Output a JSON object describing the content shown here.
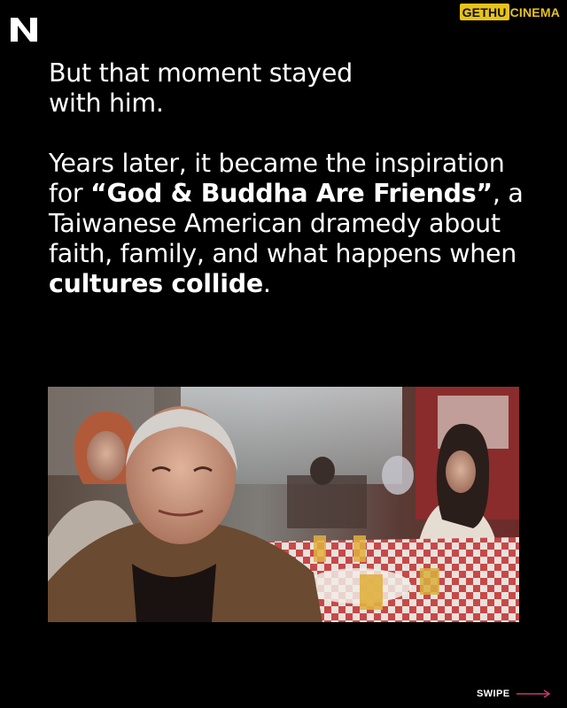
{
  "brand": {
    "part1": "GETHU",
    "part2": "CINEMA",
    "accent_color": "#e8c21a"
  },
  "logo": {
    "icon": "n-logo-icon"
  },
  "text": {
    "para1": "But that moment stayed with him.",
    "para2_segments": [
      {
        "text": "Years later, it became the inspiration for ",
        "bold": false
      },
      {
        "text": "“God & Buddha Are Friends”",
        "bold": true
      },
      {
        "text": ", a Taiwanese American dramedy about faith, family, and what happens when ",
        "bold": false
      },
      {
        "text": "cultures collide",
        "bold": true
      },
      {
        "text": ".",
        "bold": false
      }
    ]
  },
  "photo": {
    "icon": "movie-still-image"
  },
  "footer": {
    "swipe_label": "SWIPE",
    "arrow_color": "#c23b6e",
    "arrow_icon": "right-arrow-icon"
  }
}
